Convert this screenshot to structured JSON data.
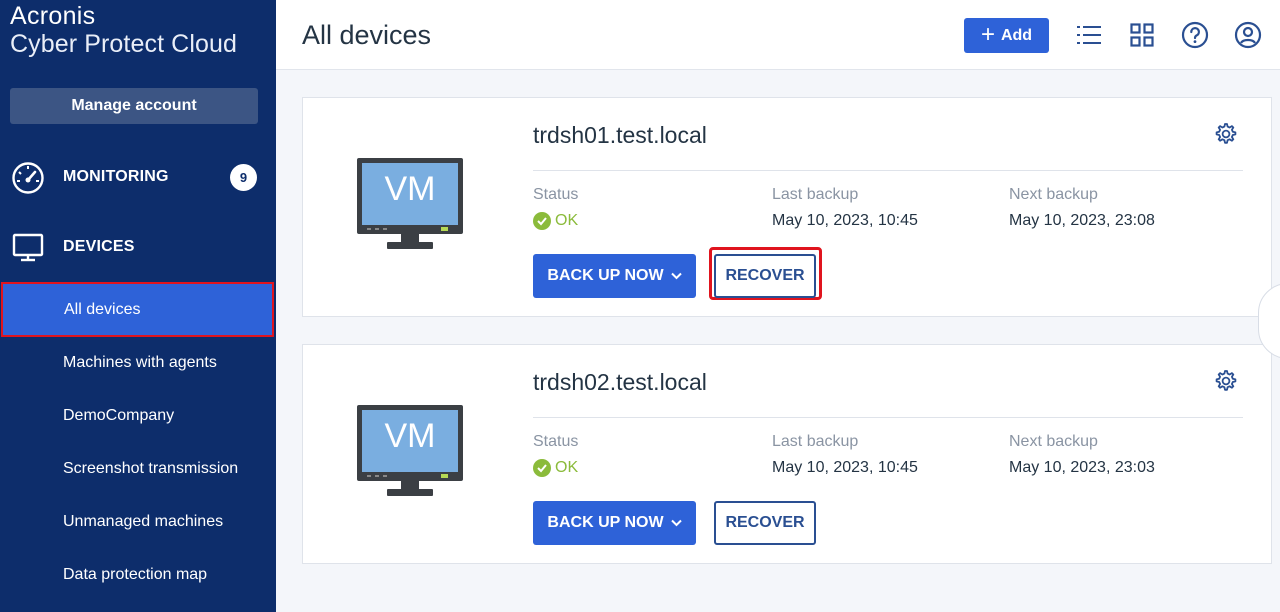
{
  "brand": {
    "line1": "Acronis",
    "line2": "Cyber Protect Cloud"
  },
  "sidebar": {
    "manage_account": "Manage account",
    "monitoring": {
      "label": "MONITORING",
      "badge": "9",
      "icon": "speedometer-icon"
    },
    "devices": {
      "label": "DEVICES",
      "icon": "monitor-icon"
    },
    "items": [
      {
        "label": "All devices",
        "active": true
      },
      {
        "label": "Machines with agents"
      },
      {
        "label": "DemoCompany"
      },
      {
        "label": "Screenshot transmission"
      },
      {
        "label": "Unmanaged machines"
      },
      {
        "label": "Data protection map"
      }
    ]
  },
  "header": {
    "title": "All devices",
    "add_label": "Add",
    "icons": [
      "list-view-icon",
      "grid-view-icon",
      "help-icon",
      "user-account-icon"
    ]
  },
  "devices": [
    {
      "name": "trdsh01.test.local",
      "icon_text": "VM",
      "status_label": "Status",
      "status_value": "OK",
      "last_backup_label": "Last backup",
      "last_backup_value": "May 10, 2023, 10:45",
      "next_backup_label": "Next backup",
      "next_backup_value": "May 10, 2023, 23:08",
      "backup_button": "BACK UP NOW",
      "recover_button": "RECOVER"
    },
    {
      "name": "trdsh02.test.local",
      "icon_text": "VM",
      "status_label": "Status",
      "status_value": "OK",
      "last_backup_label": "Last backup",
      "last_backup_value": "May 10, 2023, 10:45",
      "next_backup_label": "Next backup",
      "next_backup_value": "May 10, 2023, 23:03",
      "backup_button": "BACK UP NOW",
      "recover_button": "RECOVER"
    }
  ],
  "colors": {
    "sidebar": "#0d2d6b",
    "accent": "#2e62d8",
    "ok": "#8bbb3b",
    "highlight": "#e0141e"
  }
}
